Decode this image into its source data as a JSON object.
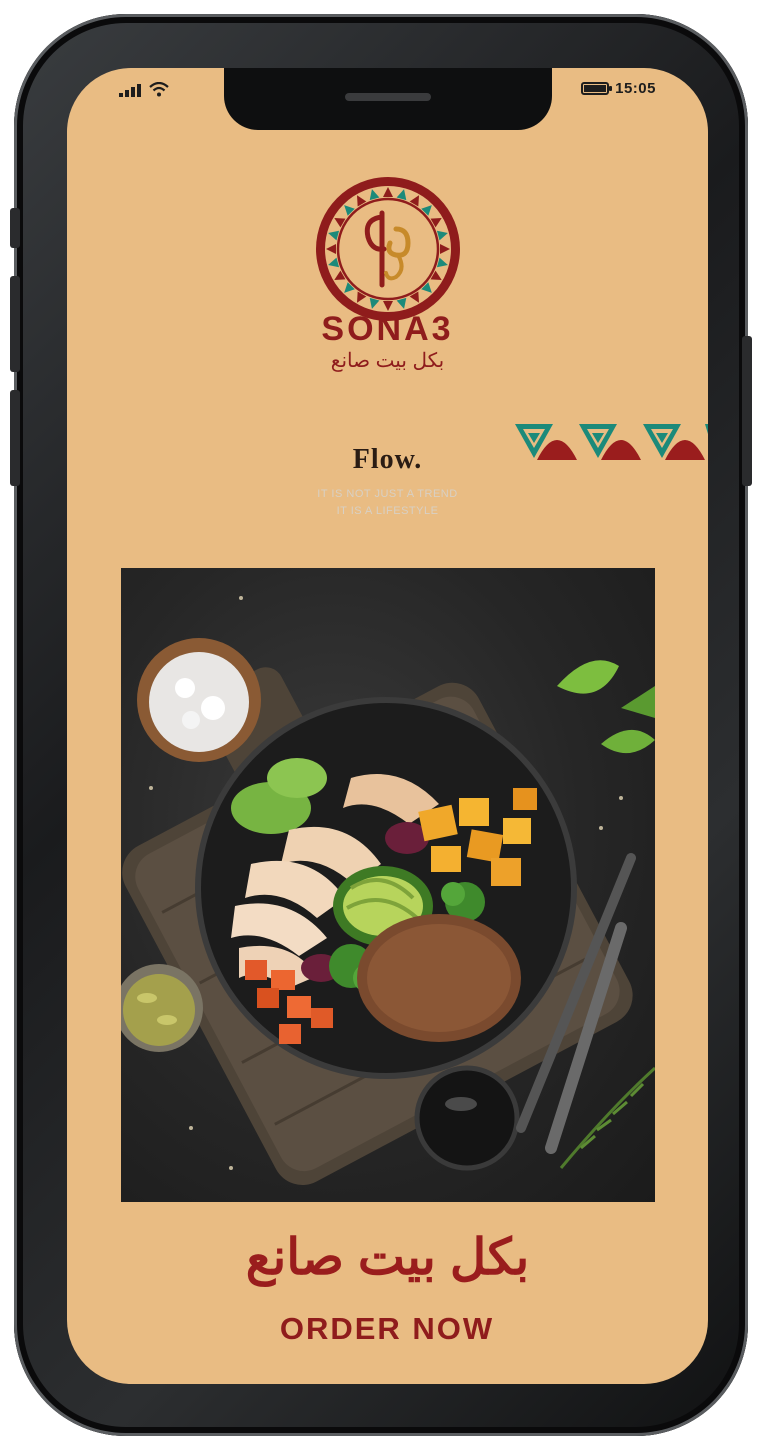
{
  "status_bar": {
    "time": "15:05"
  },
  "brand": {
    "name": "SONA3",
    "arabic_tagline": "بكل بيت صانع"
  },
  "hero": {
    "title": "Flow.",
    "subtitle_line1": "IT IS NOT JUST A TREND",
    "subtitle_line2": "IT IS A LIFESTYLE"
  },
  "footer": {
    "arabic_title": "بكل بيت صانع",
    "order_button_label": "ORDER NOW"
  },
  "colors": {
    "screen_background": "#e9bc83",
    "brand_red": "#8f1c1c",
    "pattern_teal": "#1c8a7a"
  },
  "icons": [
    "signal-icon",
    "wifi-icon",
    "battery-icon",
    "brand-logo-icon",
    "tribal-pattern-icon"
  ]
}
